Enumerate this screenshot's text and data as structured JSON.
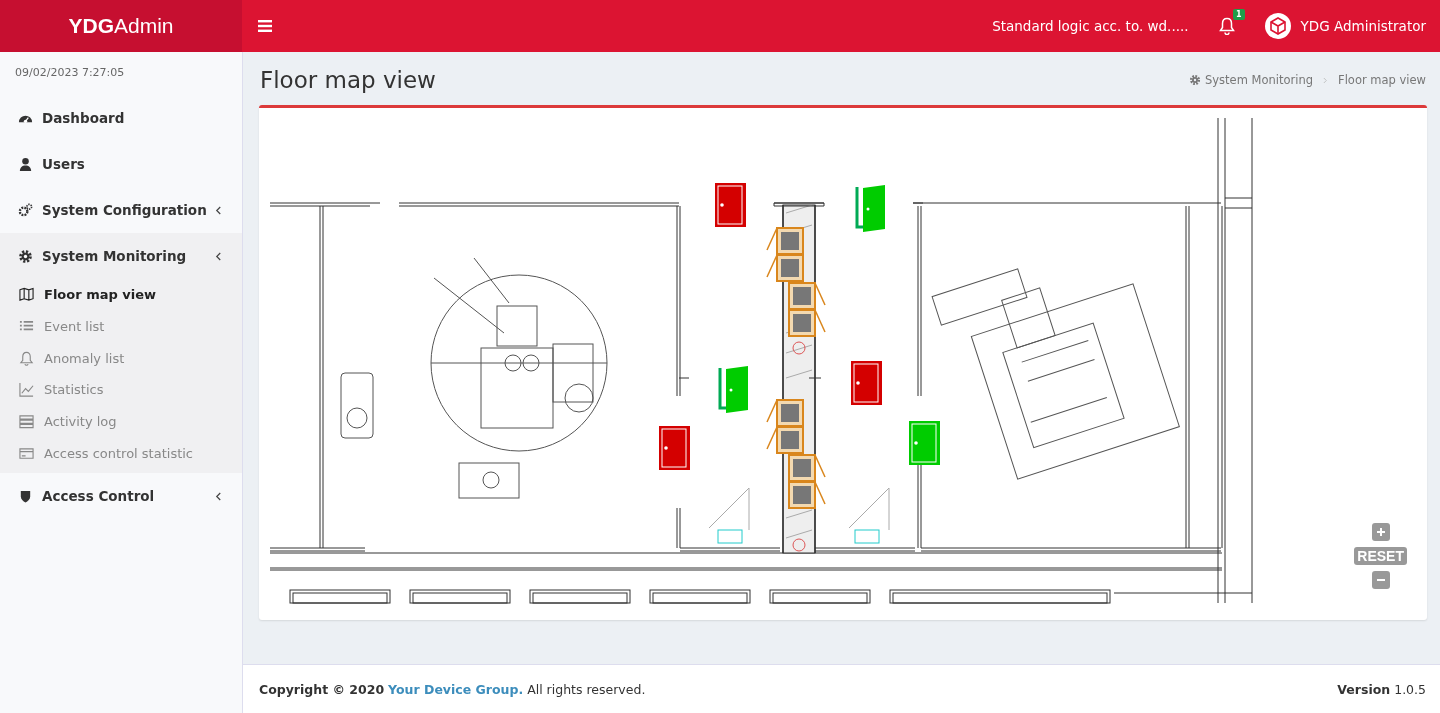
{
  "header": {
    "brand": "**YDG**Admin",
    "status_text": "Standard logic acc. to. wd.....",
    "notification_count": "1",
    "user_name": "YDG Administrator"
  },
  "sidebar": {
    "datetime": "09/02/2023 7:27:05",
    "items": [
      {
        "label": "Dashboard",
        "has_children": false,
        "expanded": false
      },
      {
        "label": "Users",
        "has_children": false,
        "expanded": false
      },
      {
        "label": "System Configuration",
        "has_children": true,
        "expanded": false
      },
      {
        "label": "System Monitoring",
        "has_children": true,
        "expanded": true,
        "children": [
          {
            "label": "Floor map view",
            "selected": true
          },
          {
            "label": "Event list",
            "selected": false
          },
          {
            "label": "Anomaly list",
            "selected": false
          },
          {
            "label": "Statistics",
            "selected": false
          },
          {
            "label": "Activity log",
            "selected": false
          },
          {
            "label": "Access control statistic",
            "selected": false
          }
        ]
      },
      {
        "label": "Access Control",
        "has_children": true,
        "expanded": false
      }
    ]
  },
  "page": {
    "title": "Floor map view",
    "breadcrumb": [
      "System Monitoring",
      "Floor map view"
    ]
  },
  "floor_map": {
    "reset_label": "RESET",
    "doors": [
      {
        "color": "#d40000",
        "open": false
      },
      {
        "color": "#00cc00",
        "open": true
      },
      {
        "color": "#00cc00",
        "open": true
      },
      {
        "color": "#d40000",
        "open": false
      },
      {
        "color": "#d40000",
        "open": false
      },
      {
        "color": "#00cc00",
        "open": false
      }
    ]
  },
  "footer": {
    "copyright": "Copyright © 2020",
    "company_link": "Your Device Group.",
    "rights": "All rights reserved.",
    "version": "**Version** 1.0.5"
  }
}
